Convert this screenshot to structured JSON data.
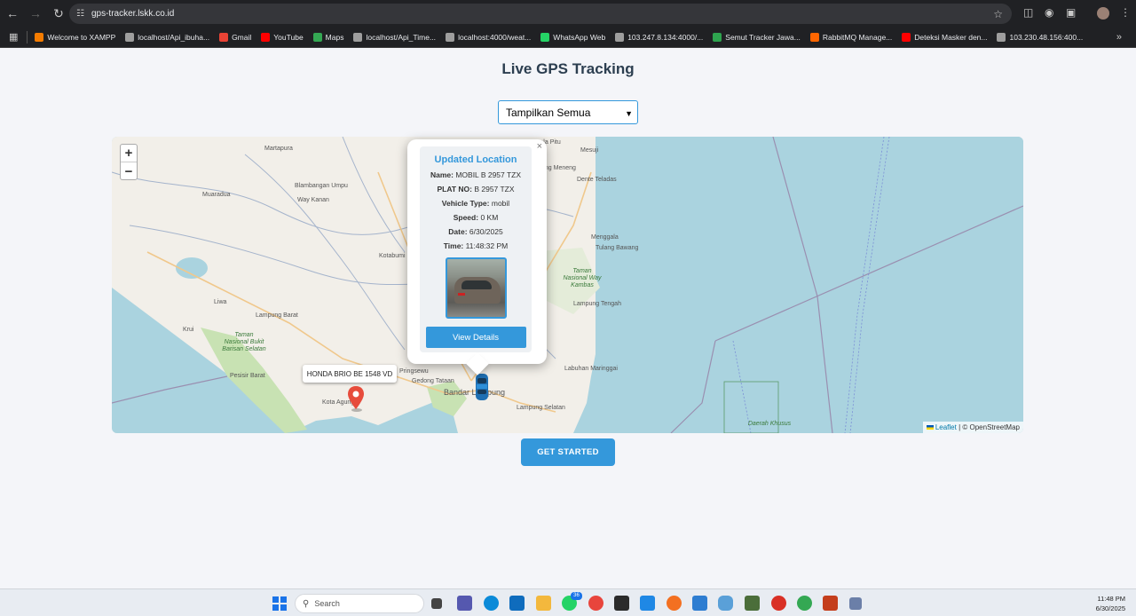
{
  "browser": {
    "url": "gps-tracker.lskk.co.id",
    "bookmarks": [
      {
        "label": "Welcome to XAMPP",
        "color": "#f57c00"
      },
      {
        "label": "localhost/Api_ibuha...",
        "color": "#9e9e9e"
      },
      {
        "label": "Gmail",
        "color": "#ea4335"
      },
      {
        "label": "YouTube",
        "color": "#ff0000"
      },
      {
        "label": "Maps",
        "color": "#34a853"
      },
      {
        "label": "localhost/Api_Time...",
        "color": "#9e9e9e"
      },
      {
        "label": "localhost:4000/weat...",
        "color": "#9e9e9e"
      },
      {
        "label": "WhatsApp Web",
        "color": "#25d366"
      },
      {
        "label": "103.247.8.134:4000/...",
        "color": "#9e9e9e"
      },
      {
        "label": "Semut Tracker Jawa...",
        "color": "#2ea44f"
      },
      {
        "label": "RabbitMQ Manage...",
        "color": "#ff6600"
      },
      {
        "label": "Deteksi Masker den...",
        "color": "#ff0000"
      },
      {
        "label": "103.230.48.156:400...",
        "color": "#9e9e9e"
      }
    ]
  },
  "page": {
    "title": "Live GPS Tracking",
    "filter_selected": "Tampilkan Semua",
    "get_started": "GET STARTED"
  },
  "map": {
    "zoom_in": "+",
    "zoom_out": "−",
    "attribution_leaflet": "Leaflet",
    "attribution_rest": "| © OpenStreetMap",
    "place_labels": [
      "Martapura",
      "Muaradua",
      "Blambangan Umpu",
      "Way Kanan",
      "Kotabumi",
      "Liwa",
      "Lampung Barat",
      "Krui",
      "Taman Nasional Bukit Barisan Selatan",
      "Pesisir Barat",
      "Taman Nasional Way Kambas",
      "Labuhan Maringgai",
      "Pringsewu",
      "Gedong Tataan",
      "Bandar Lampung",
      "Kota Agung",
      "Lampung Selatan",
      "Daerah Khusus",
      "Dente Teladas",
      "Menggala",
      "Tulang Bawang",
      "Lampung Tengah",
      "Mesuji",
      "Menggala Pitu",
      "ung Meneng"
    ],
    "marker_tooltip": "HONDA BRIO BE 1548 VD"
  },
  "popup": {
    "close": "×",
    "heading": "Updated Location",
    "fields": [
      {
        "label": "Name:",
        "value": "MOBIL B 2957 TZX"
      },
      {
        "label": "PLAT NO:",
        "value": "B 2957 TZX"
      },
      {
        "label": "Vehicle Type:",
        "value": "mobil"
      },
      {
        "label": "Speed:",
        "value": "0 KM"
      },
      {
        "label": "Date:",
        "value": "6/30/2025"
      },
      {
        "label": "Time:",
        "value": "11:48:32 PM"
      }
    ],
    "button": "View Details"
  },
  "taskbar": {
    "search_placeholder": "Search",
    "whatsapp_badge": "36",
    "time": "11:48 PM",
    "date": "6/30/2025"
  }
}
